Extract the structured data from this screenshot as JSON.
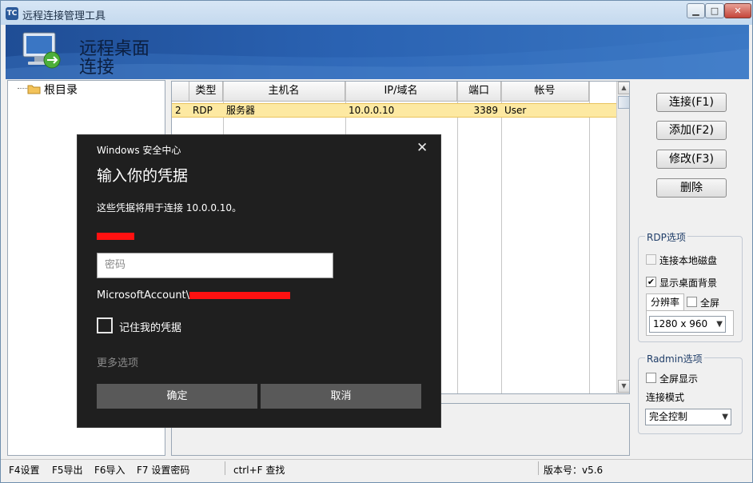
{
  "window": {
    "title": "远程连接管理工具",
    "icon_text": "TC"
  },
  "banner": {
    "title_line1": "远程桌面",
    "title_line2": "连接"
  },
  "tree": {
    "root_label": "根目录"
  },
  "grid": {
    "columns": [
      "类型",
      "主机名",
      "IP/域名",
      "端口",
      "帐号"
    ],
    "rows": [
      {
        "index": "2",
        "type": "RDP",
        "host": "服务器",
        "ip": "10.0.0.10",
        "port": "3389",
        "account": "User"
      }
    ]
  },
  "buttons": {
    "connect": "连接(F1)",
    "add": "添加(F2)",
    "edit": "修改(F3)",
    "delete": "删除"
  },
  "rdp_options": {
    "label": "RDP选项",
    "local_disk": {
      "label": "连接本地磁盘",
      "checked": false
    },
    "show_background": {
      "label": "显示桌面背景",
      "checked": true
    },
    "resolution_tab": "分辨率",
    "fullscreen": {
      "label": "全屏",
      "checked": false
    },
    "resolution_value": "1280 x 960"
  },
  "radmin_options": {
    "label": "Radmin选项",
    "fullscreen": {
      "label": "全屏显示",
      "checked": false
    },
    "mode_label": "连接模式",
    "mode_value": "完全控制"
  },
  "statusbar": {
    "f4": "F4设置",
    "f5": "F5导出",
    "f6": "F6导入",
    "f7": "F7 设置密码",
    "find": "ctrl+F 查找",
    "version": "版本号：v5.6"
  },
  "dialog": {
    "header": "Windows 安全中心",
    "title": "输入你的凭据",
    "description": "这些凭据将用于连接 10.0.0.10。",
    "password_placeholder": "密码",
    "account_prefix": "MicrosoftAccount\\",
    "remember_label": "记住我的凭据",
    "more_options": "更多选项",
    "ok": "确定",
    "cancel": "取消"
  },
  "colors": {
    "banner": "#2a62b2",
    "selected_row": "#fde9a2",
    "dialog_bg": "#1f1f1f",
    "redaction": "#ff1111"
  }
}
